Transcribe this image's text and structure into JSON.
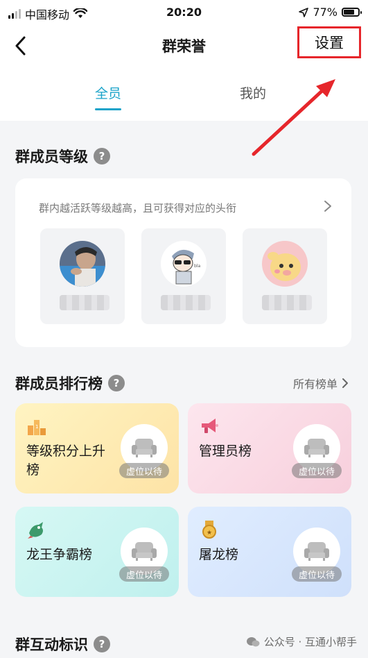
{
  "status_bar": {
    "carrier": "中国移动",
    "time": "20:20",
    "battery": "77%",
    "battery_level": 0.77
  },
  "nav": {
    "title": "群荣誉",
    "settings_label": "设置"
  },
  "tabs": [
    {
      "label": "全员",
      "active": true
    },
    {
      "label": "我的",
      "active": false
    }
  ],
  "level_section": {
    "title": "群成员等级",
    "description": "群内越活跃等级越高，且可获得对应的头衔",
    "members": [
      {
        "avatar": "avatar-man-photo"
      },
      {
        "avatar": "avatar-cartoon-sunglasses"
      },
      {
        "avatar": "avatar-cartoon-pig"
      }
    ]
  },
  "ranking_section": {
    "title": "群成员排行榜",
    "all_lists_label": "所有榜单",
    "cards": [
      {
        "label": "等级积分上升榜",
        "icon": "podium-icon",
        "vacant": "虚位以待"
      },
      {
        "label": "管理员榜",
        "icon": "megaphone-icon",
        "vacant": "虚位以待"
      },
      {
        "label": "龙王争霸榜",
        "icon": "dragon-icon",
        "vacant": "虚位以待"
      },
      {
        "label": "屠龙榜",
        "icon": "medal-icon",
        "vacant": "虚位以待"
      }
    ]
  },
  "interaction_section": {
    "title": "群互动标识"
  },
  "watermark": "公众号 · 互通小帮手",
  "colors": {
    "accent": "#1aa3c9",
    "annotation_red": "#e6262b"
  }
}
